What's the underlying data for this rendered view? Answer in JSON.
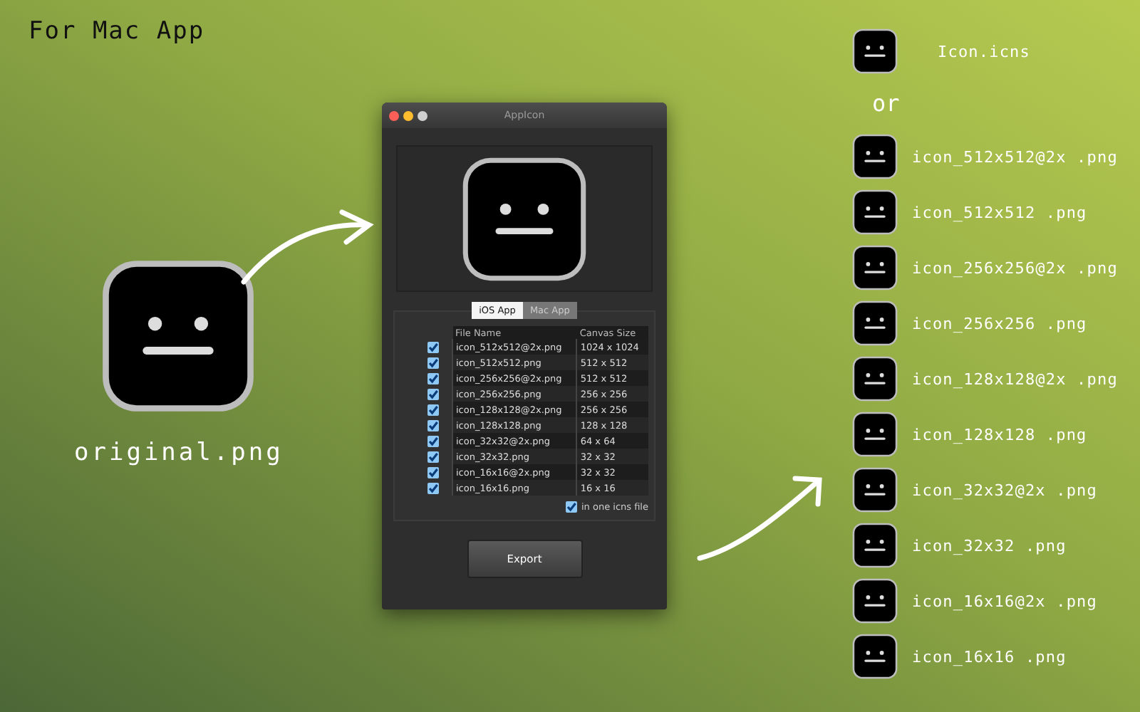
{
  "header": {
    "title": "For Mac App"
  },
  "source": {
    "filename": "original.png"
  },
  "window": {
    "title": "AppIcon",
    "tabs": [
      {
        "label": "iOS App",
        "selected": true
      },
      {
        "label": "Mac App",
        "selected": false
      }
    ],
    "table": {
      "columns": [
        "File Name",
        "Canvas Size"
      ],
      "rows": [
        {
          "checked": true,
          "file": "icon_512x512@2x.png",
          "size": "1024 x 1024"
        },
        {
          "checked": true,
          "file": "icon_512x512.png",
          "size": "512 x 512"
        },
        {
          "checked": true,
          "file": "icon_256x256@2x.png",
          "size": "512 x 512"
        },
        {
          "checked": true,
          "file": "icon_256x256.png",
          "size": "256 x 256"
        },
        {
          "checked": true,
          "file": "icon_128x128@2x.png",
          "size": "256 x 256"
        },
        {
          "checked": true,
          "file": "icon_128x128.png",
          "size": "128 x 128"
        },
        {
          "checked": true,
          "file": "icon_32x32@2x.png",
          "size": "64 x 64"
        },
        {
          "checked": true,
          "file": "icon_32x32.png",
          "size": "32 x 32"
        },
        {
          "checked": true,
          "file": "icon_16x16@2x.png",
          "size": "32 x 32"
        },
        {
          "checked": true,
          "file": "icon_16x16.png",
          "size": "16 x 16"
        }
      ]
    },
    "single_file": {
      "label": "in one icns file",
      "checked": true
    },
    "export_button": "Export"
  },
  "outputs": {
    "icns": "Icon.icns",
    "separator": "or",
    "files": [
      "icon_512x512@2x .png",
      "icon_512x512 .png",
      "icon_256x256@2x .png",
      "icon_256x256 .png",
      "icon_128x128@2x .png",
      "icon_128x128 .png",
      "icon_32x32@2x .png",
      "icon_32x32 .png",
      "icon_16x16@2x .png",
      "icon_16x16 .png"
    ]
  }
}
